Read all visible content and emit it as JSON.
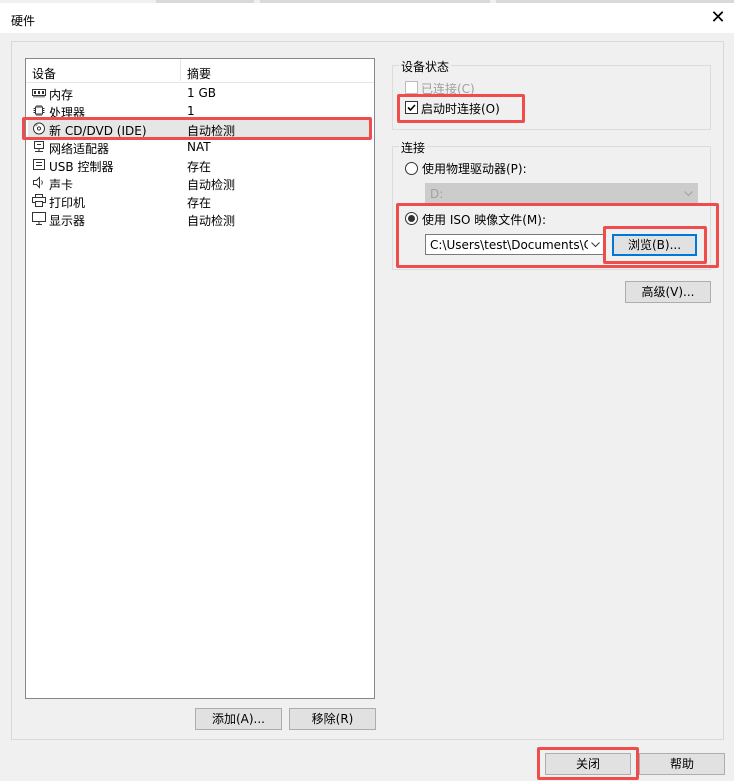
{
  "window": {
    "title": "硬件",
    "close_glyph": "✕"
  },
  "device_list": {
    "columns": {
      "device": "设备",
      "summary": "摘要"
    },
    "items": [
      {
        "icon": "memory-icon",
        "name": "内存",
        "summary": "1 GB"
      },
      {
        "icon": "processor-icon",
        "name": "处理器",
        "summary": "1"
      },
      {
        "icon": "cd-dvd-icon",
        "name": "新 CD/DVD (IDE)",
        "summary": "自动检测",
        "selected": true
      },
      {
        "icon": "network-adapter-icon",
        "name": "网络适配器",
        "summary": "NAT"
      },
      {
        "icon": "usb-controller-icon",
        "name": "USB 控制器",
        "summary": "存在"
      },
      {
        "icon": "sound-card-icon",
        "name": "声卡",
        "summary": "自动检测"
      },
      {
        "icon": "printer-icon",
        "name": "打印机",
        "summary": "存在"
      },
      {
        "icon": "display-icon",
        "name": "显示器",
        "summary": "自动检测"
      }
    ],
    "add_label": "添加(A)...",
    "remove_label": "移除(R)"
  },
  "device_status": {
    "title": "设备状态",
    "connected_label": "已连接(C)",
    "connected_checked": false,
    "connected_enabled": false,
    "connect_at_power_on_label": "启动时连接(O)",
    "connect_at_power_on_checked": true
  },
  "connection": {
    "title": "连接",
    "physical_drive_label": "使用物理驱动器(P):",
    "physical_drive_selected": false,
    "physical_drive_value": "D:",
    "iso_label": "使用 ISO 映像文件(M):",
    "iso_selected": true,
    "iso_path": "C:\\Users\\test\\Documents\\Cc",
    "browse_label": "浏览(B)..."
  },
  "advanced_label": "高级(V)...",
  "footer": {
    "close_label": "关闭",
    "help_label": "帮助"
  },
  "colors": {
    "highlight": "#ef4c4c",
    "focus": "#0078d7",
    "selected_row": "#e6e6e6"
  }
}
